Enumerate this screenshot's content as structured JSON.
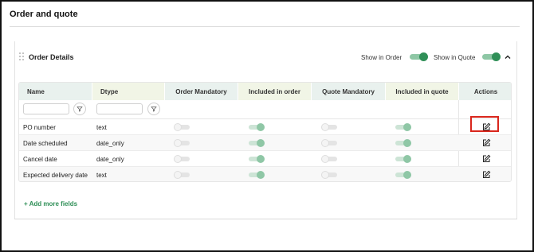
{
  "page": {
    "title": "Order and quote"
  },
  "section": {
    "title": "Order Details",
    "show_in_order_label": "Show in Order",
    "show_in_order": true,
    "show_in_quote_label": "Show in Quote",
    "show_in_quote": true
  },
  "table": {
    "columns": [
      "Name",
      "Dtype",
      "Order Mandatory",
      "Included in order",
      "Quote Mandatory",
      "Included in quote",
      "Actions"
    ],
    "filters": {
      "name_value": "",
      "dtype_value": ""
    },
    "rows": [
      {
        "name": "PO number",
        "dtype": "text",
        "order_mandatory": false,
        "included_in_order": true,
        "quote_mandatory": false,
        "included_in_quote": true
      },
      {
        "name": "Date scheduled",
        "dtype": "date_only",
        "order_mandatory": false,
        "included_in_order": true,
        "quote_mandatory": false,
        "included_in_quote": true
      },
      {
        "name": "Cancel date",
        "dtype": "date_only",
        "order_mandatory": false,
        "included_in_order": true,
        "quote_mandatory": false,
        "included_in_quote": true
      },
      {
        "name": "Expected delivery date",
        "dtype": "text",
        "order_mandatory": false,
        "included_in_order": true,
        "quote_mandatory": false,
        "included_in_quote": true
      }
    ]
  },
  "footer": {
    "add_more_label": "+ Add more fields"
  },
  "colors": {
    "accent": "#2f8f57",
    "highlight": "#d9261c",
    "header_green": "#e9f1ee",
    "header_lime": "#f1f5e6"
  },
  "icons": {
    "drag": "drag-handle-icon",
    "collapse": "chevron-up-icon",
    "filter": "filter-icon",
    "edit": "edit-icon"
  }
}
